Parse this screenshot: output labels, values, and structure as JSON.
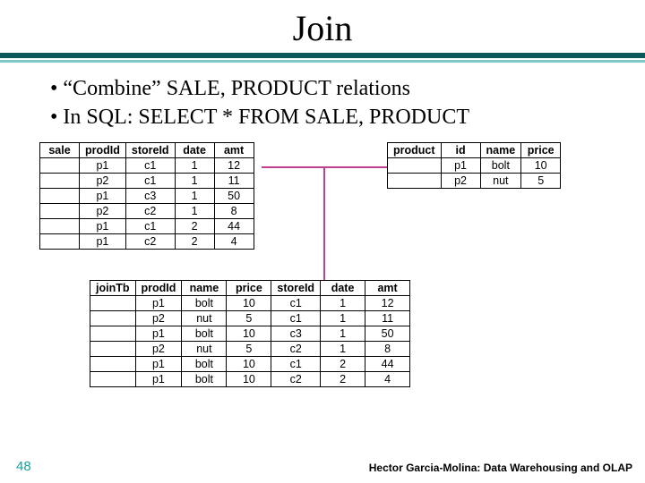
{
  "title": "Join",
  "bullets": [
    "“Combine” SALE, PRODUCT relations",
    "In SQL:  SELECT * FROM SALE, PRODUCT"
  ],
  "sale": {
    "headers": [
      "sale",
      "prodId",
      "storeId",
      "date",
      "amt"
    ],
    "rows": [
      [
        "",
        "p1",
        "c1",
        "1",
        "12"
      ],
      [
        "",
        "p2",
        "c1",
        "1",
        "11"
      ],
      [
        "",
        "p1",
        "c3",
        "1",
        "50"
      ],
      [
        "",
        "p2",
        "c2",
        "1",
        "8"
      ],
      [
        "",
        "p1",
        "c1",
        "2",
        "44"
      ],
      [
        "",
        "p1",
        "c2",
        "2",
        "4"
      ]
    ]
  },
  "product": {
    "headers": [
      "product",
      "id",
      "name",
      "price"
    ],
    "rows": [
      [
        "",
        "p1",
        "bolt",
        "10"
      ],
      [
        "",
        "p2",
        "nut",
        "5"
      ]
    ]
  },
  "join": {
    "headers": [
      "joinTb",
      "prodId",
      "name",
      "price",
      "storeId",
      "date",
      "amt"
    ],
    "rows": [
      [
        "",
        "p1",
        "bolt",
        "10",
        "c1",
        "1",
        "12"
      ],
      [
        "",
        "p2",
        "nut",
        "5",
        "c1",
        "1",
        "11"
      ],
      [
        "",
        "p1",
        "bolt",
        "10",
        "c3",
        "1",
        "50"
      ],
      [
        "",
        "p2",
        "nut",
        "5",
        "c2",
        "1",
        "8"
      ],
      [
        "",
        "p1",
        "bolt",
        "10",
        "c1",
        "2",
        "44"
      ],
      [
        "",
        "p1",
        "bolt",
        "10",
        "c2",
        "2",
        "4"
      ]
    ]
  },
  "slide_number": "48",
  "credit": "Hector Garcia-Molina: Data Warehousing and OLAP"
}
